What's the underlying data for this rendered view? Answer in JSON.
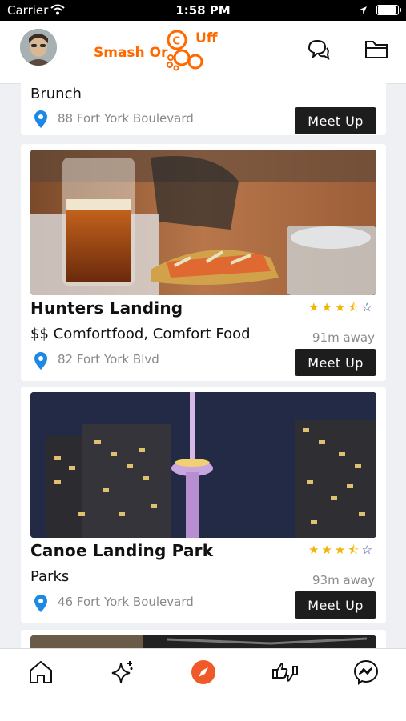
{
  "status_bar": {
    "carrier": "Carrier",
    "time": "1:58 PM",
    "battery_level": 0.95
  },
  "header": {
    "logo": {
      "word1": "Smash Or",
      "word2": "Uff",
      "color": "#ff6a00"
    },
    "icons": [
      "chat-bubbles-icon",
      "folder-icon"
    ]
  },
  "venues": [
    {
      "name": "",
      "category": "Brunch",
      "distance": "",
      "address": "88 Fort York Boulevard",
      "meet_label": "Meet Up"
    },
    {
      "name": "Hunters Landing",
      "rating": 3.5,
      "category": "$$ Comfortfood, Comfort Food",
      "distance": "91m away",
      "address": "82 Fort York Blvd",
      "meet_label": "Meet Up"
    },
    {
      "name": "Canoe Landing Park",
      "rating": 3.5,
      "category": "Parks",
      "distance": "93m away",
      "address": "46 Fort York Boulevard",
      "meet_label": "Meet Up"
    }
  ],
  "tab_bar": {
    "items": [
      "home-icon",
      "sparkles-icon",
      "compass-icon",
      "thumbs-icon",
      "messenger-icon"
    ],
    "active_index": 2,
    "active_color": "#f05a28"
  },
  "colors": {
    "button_bg": "#1d1d1d",
    "pin": "#1e88e5",
    "star": "#f2b500"
  }
}
